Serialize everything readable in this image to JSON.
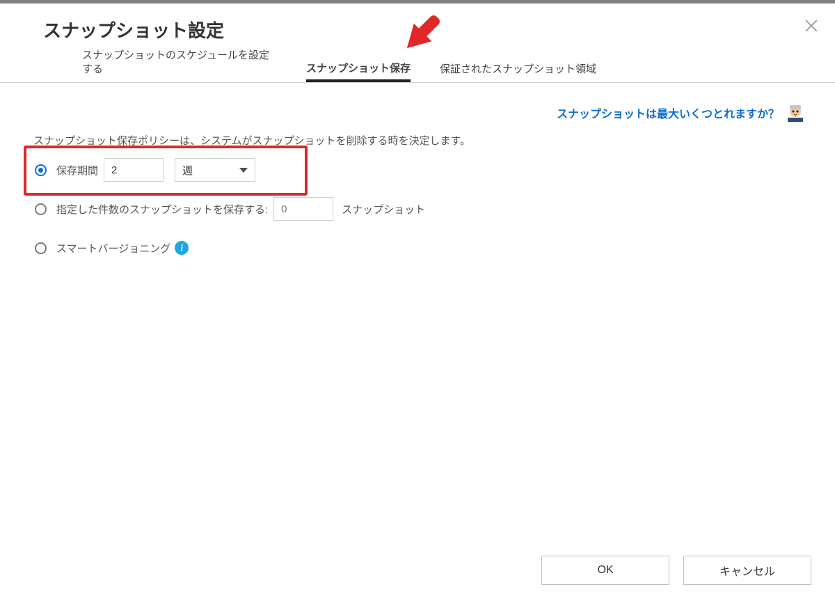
{
  "dialog": {
    "title": "スナップショット設定"
  },
  "tabs": {
    "items": [
      {
        "label": "スナップショットのスケジュールを設定する",
        "active": false
      },
      {
        "label": "スナップショット保存",
        "active": true
      },
      {
        "label": "保証されたスナップショット領域",
        "active": false
      }
    ]
  },
  "help": {
    "link_text": "スナップショットは最大いくつとれますか？"
  },
  "description": "スナップショット保存ポリシーは、システムがスナップショットを削除する時を決定します。",
  "options": {
    "keep_for": {
      "label": "保存期間",
      "value": "2",
      "unit_selected": "週",
      "selected": true
    },
    "keep_count": {
      "label": "指定した件数のスナップショットを保存する:",
      "placeholder": "0",
      "value": "",
      "suffix": "スナップショット",
      "selected": false
    },
    "smart_versioning": {
      "label": "スマートバージョニング",
      "selected": false
    }
  },
  "footer": {
    "ok": "OK",
    "cancel": "キャンセル"
  }
}
